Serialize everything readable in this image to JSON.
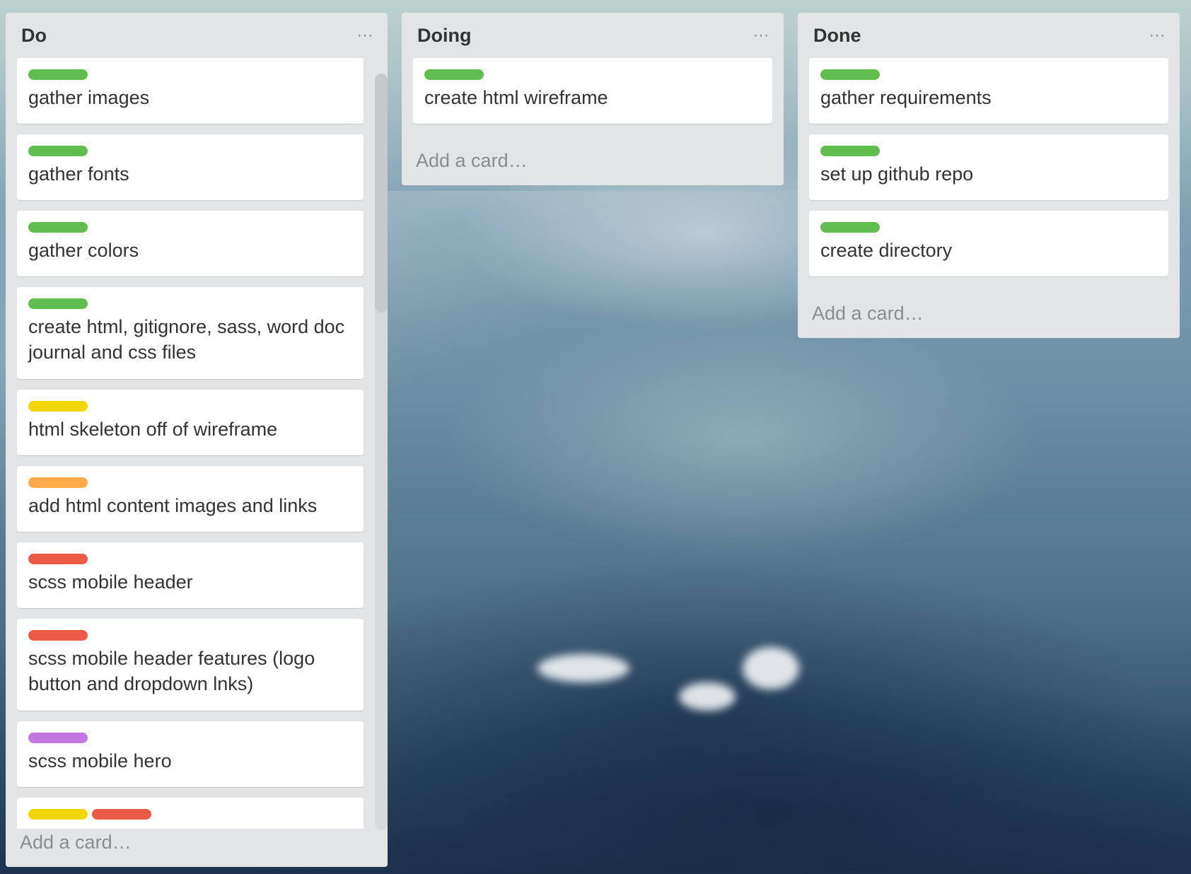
{
  "colors": {
    "green": "#61bd4f",
    "yellow": "#f2d600",
    "orange": "#ffab4a",
    "red": "#eb5a46",
    "purple": "#c377e0"
  },
  "icons": {
    "list_menu": "ellipsis-icon"
  },
  "lists": [
    {
      "title": "Do",
      "menu": "···",
      "add_card": "Add a card…",
      "cards": [
        {
          "labels": [
            "green"
          ],
          "text": "gather images"
        },
        {
          "labels": [
            "green"
          ],
          "text": "gather fonts"
        },
        {
          "labels": [
            "green"
          ],
          "text": "gather colors"
        },
        {
          "labels": [
            "green"
          ],
          "text": "create html, gitignore, sass, word doc journal and css files"
        },
        {
          "labels": [
            "yellow"
          ],
          "text": "html skeleton off of wireframe"
        },
        {
          "labels": [
            "orange"
          ],
          "text": "add html content images and links"
        },
        {
          "labels": [
            "red"
          ],
          "text": "scss mobile header"
        },
        {
          "labels": [
            "red"
          ],
          "text": "scss mobile header features (logo button and dropdown lnks)"
        },
        {
          "labels": [
            "purple"
          ],
          "text": "scss mobile hero"
        },
        {
          "labels": [
            "yellow",
            "red"
          ],
          "text": ""
        }
      ]
    },
    {
      "title": "Doing",
      "menu": "···",
      "add_card": "Add a card…",
      "cards": [
        {
          "labels": [
            "green"
          ],
          "text": "create html wireframe"
        }
      ]
    },
    {
      "title": "Done",
      "menu": "···",
      "add_card": "Add a card…",
      "cards": [
        {
          "labels": [
            "green"
          ],
          "text": "gather requirements"
        },
        {
          "labels": [
            "green"
          ],
          "text": "set up github repo"
        },
        {
          "labels": [
            "green"
          ],
          "text": "create directory"
        }
      ]
    }
  ]
}
